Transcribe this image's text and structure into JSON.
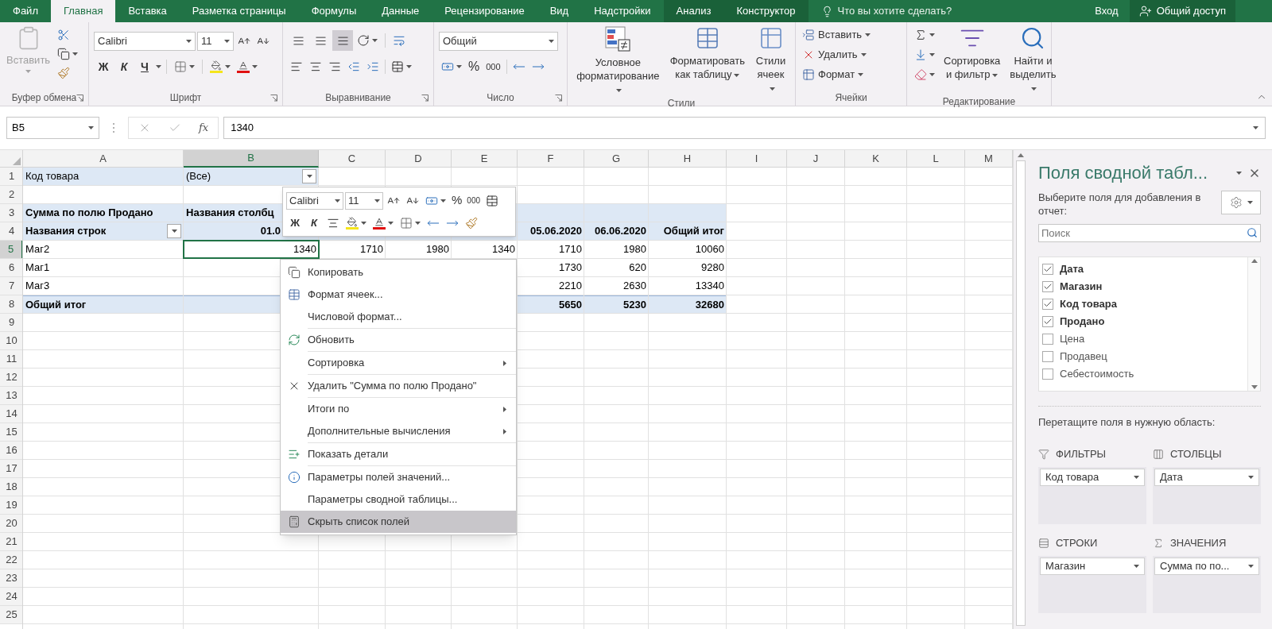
{
  "tabs": [
    {
      "label": "Файл",
      "selected": false,
      "contextual": false
    },
    {
      "label": "Главная",
      "selected": true,
      "contextual": false
    },
    {
      "label": "Вставка",
      "selected": false,
      "contextual": false
    },
    {
      "label": "Разметка страницы",
      "selected": false,
      "contextual": false
    },
    {
      "label": "Формулы",
      "selected": false,
      "contextual": false
    },
    {
      "label": "Данные",
      "selected": false,
      "contextual": false
    },
    {
      "label": "Рецензирование",
      "selected": false,
      "contextual": false
    },
    {
      "label": "Вид",
      "selected": false,
      "contextual": false
    },
    {
      "label": "Надстройки",
      "selected": false,
      "contextual": false
    },
    {
      "label": "Анализ",
      "selected": false,
      "contextual": true
    },
    {
      "label": "Конструктор",
      "selected": false,
      "contextual": true
    }
  ],
  "tell_me": {
    "placeholder": "Что вы хотите сделать?"
  },
  "account": {
    "sign_in": "Вход",
    "share": "Общий доступ"
  },
  "ribbon": {
    "clipboard": {
      "title": "Буфер обмена",
      "paste": {
        "label": "Вставить",
        "disabled": true
      }
    },
    "font": {
      "title": "Шрифт",
      "font": "Calibri",
      "size": "11",
      "bold": "Ж",
      "italic": "К",
      "underline": "Ч"
    },
    "alignment": {
      "title": "Выравнивание",
      "vertical": [
        {
          "selected": false
        },
        {
          "selected": false
        },
        {
          "selected": true
        }
      ]
    },
    "number": {
      "title": "Число",
      "format": "Общий",
      "percent": "%",
      "thousands": "000"
    },
    "styles": {
      "title": "Стили",
      "buttons": [
        {
          "kind": "conditional",
          "lines": [
            "Условное",
            "форматирование"
          ]
        },
        {
          "kind": "table",
          "lines": [
            "Форматировать",
            "как таблицу"
          ]
        },
        {
          "kind": "cell-styles",
          "lines": [
            "Стили",
            "ячеек"
          ]
        }
      ]
    },
    "cells": {
      "title": "Ячейки",
      "buttons": [
        {
          "kind": "insert",
          "label": "Вставить"
        },
        {
          "kind": "delete",
          "label": "Удалить"
        },
        {
          "kind": "format",
          "label": "Формат"
        }
      ]
    },
    "editing": {
      "title": "Редактирование",
      "buttons": [
        {
          "kind": "sort",
          "lines": [
            "Сортировка",
            "и фильтр"
          ]
        },
        {
          "kind": "find",
          "lines": [
            "Найти и",
            "выделить"
          ]
        }
      ]
    }
  },
  "formula_bar": {
    "name_box": "B5",
    "fx": "fx",
    "value": "1340"
  },
  "sheet": {
    "columns": [
      {
        "label": "A",
        "selected": false
      },
      {
        "label": "B",
        "selected": true
      },
      {
        "label": "C",
        "selected": false
      },
      {
        "label": "D",
        "selected": false
      },
      {
        "label": "E",
        "selected": false
      },
      {
        "label": "F",
        "selected": false
      },
      {
        "label": "G",
        "selected": false
      },
      {
        "label": "H",
        "selected": false
      },
      {
        "label": "I",
        "selected": false
      },
      {
        "label": "J",
        "selected": false
      },
      {
        "label": "K",
        "selected": false
      },
      {
        "label": "L",
        "selected": false
      },
      {
        "label": "M",
        "selected": false
      }
    ],
    "rows": [
      {
        "label": "1",
        "selected": false,
        "kind": "filter",
        "label_cells": [
          {
            "text": "Код товара",
            "kind": "text",
            "bold": false,
            "selected": false
          },
          {
            "text": "(Все)",
            "kind": "filter",
            "bold": false,
            "selected": false
          }
        ]
      },
      {
        "label": "2",
        "selected": false,
        "kind": "plain"
      },
      {
        "label": "3",
        "selected": false,
        "kind": "header",
        "label_cells": [
          {
            "text": "Сумма по полю Продано",
            "kind": "text",
            "bold": true,
            "selected": false
          },
          {
            "text": "Названия столбц",
            "kind": "text",
            "bold": true,
            "selected": false
          }
        ]
      },
      {
        "label": "4",
        "selected": false,
        "kind": "header",
        "label_cells": [
          {
            "text": "Названия строк",
            "kind": "filter",
            "bold": true,
            "selected": false
          },
          {
            "text": "01.0",
            "kind": "partial",
            "bold": true,
            "selected": false
          }
        ],
        "value_cells": [
          {
            "text": "05.06.2020",
            "bold": true,
            "selected": false
          },
          {
            "text": "06.06.2020",
            "bold": true,
            "selected": false
          },
          {
            "text": "Общий итог",
            "bold": true,
            "selected": false
          }
        ]
      },
      {
        "label": "5",
        "selected": true,
        "kind": "plain",
        "label_cells": [
          {
            "text": "Маг2",
            "kind": "text",
            "bold": false,
            "selected": false
          }
        ],
        "value_cells": [
          {
            "text": "1340",
            "bold": false,
            "selected": true
          },
          {
            "text": "1710",
            "bold": false,
            "selected": false
          },
          {
            "text": "1980",
            "bold": false,
            "selected": false
          },
          {
            "text": "1340",
            "bold": false,
            "selected": false
          },
          {
            "text": "1710",
            "bold": false,
            "selected": false
          },
          {
            "text": "1980",
            "bold": false,
            "selected": false
          },
          {
            "text": "10060",
            "bold": false,
            "selected": false
          }
        ]
      },
      {
        "label": "6",
        "selected": false,
        "kind": "plain",
        "label_cells": [
          {
            "text": "Маг1",
            "kind": "text",
            "bold": false,
            "selected": false
          }
        ],
        "value_cells": [
          {
            "text": "1730",
            "bold": false,
            "selected": false
          },
          {
            "text": "620",
            "bold": false,
            "selected": false
          },
          {
            "text": "9280",
            "bold": false,
            "selected": false
          }
        ]
      },
      {
        "label": "7",
        "selected": false,
        "kind": "plain",
        "label_cells": [
          {
            "text": "Маг3",
            "kind": "text",
            "bold": false,
            "selected": false
          }
        ],
        "value_cells": [
          {
            "text": "2210",
            "bold": false,
            "selected": false
          },
          {
            "text": "2630",
            "bold": false,
            "selected": false
          },
          {
            "text": "13340",
            "bold": false,
            "selected": false
          }
        ]
      },
      {
        "label": "8",
        "selected": false,
        "kind": "total",
        "label_cells": [
          {
            "text": "Общий итог",
            "kind": "text",
            "bold": true,
            "selected": false
          }
        ],
        "value_cells": [
          {
            "text": "5650",
            "bold": true,
            "selected": false
          },
          {
            "text": "5230",
            "bold": true,
            "selected": false
          },
          {
            "text": "32680",
            "bold": true,
            "selected": false
          }
        ]
      },
      {
        "label": "9",
        "selected": false,
        "kind": "plain"
      },
      {
        "label": "10",
        "selected": false,
        "kind": "plain"
      },
      {
        "label": "11",
        "selected": false,
        "kind": "plain"
      },
      {
        "label": "12",
        "selected": false,
        "kind": "plain"
      },
      {
        "label": "13",
        "selected": false,
        "kind": "plain"
      },
      {
        "label": "14",
        "selected": false,
        "kind": "plain"
      },
      {
        "label": "15",
        "selected": false,
        "kind": "plain"
      },
      {
        "label": "16",
        "selected": false,
        "kind": "plain"
      },
      {
        "label": "17",
        "selected": false,
        "kind": "plain"
      },
      {
        "label": "18",
        "selected": false,
        "kind": "plain"
      },
      {
        "label": "19",
        "selected": false,
        "kind": "plain"
      },
      {
        "label": "20",
        "selected": false,
        "kind": "plain"
      },
      {
        "label": "21",
        "selected": false,
        "kind": "plain"
      },
      {
        "label": "22",
        "selected": false,
        "kind": "plain"
      },
      {
        "label": "23",
        "selected": false,
        "kind": "plain"
      },
      {
        "label": "24",
        "selected": false,
        "kind": "plain"
      },
      {
        "label": "25",
        "selected": false,
        "kind": "plain"
      }
    ]
  },
  "mini_toolbar": {
    "font": "Calibri",
    "size": "11",
    "percent": "%",
    "thousands": "000",
    "bold": "Ж",
    "italic": "К"
  },
  "context_menu": {
    "groups": [
      [
        {
          "label": "Копировать",
          "kind": "copy",
          "submenu": false,
          "selected": false
        },
        {
          "label": "Формат ячеек...",
          "kind": "format-cells",
          "submenu": false,
          "selected": false
        },
        {
          "label": "Числовой формат...",
          "kind": "none",
          "submenu": false,
          "selected": false
        }
      ],
      [
        {
          "label": "Обновить",
          "kind": "refresh",
          "submenu": false,
          "selected": false
        }
      ],
      [
        {
          "label": "Сортировка",
          "kind": "none",
          "submenu": true,
          "selected": false
        }
      ],
      [
        {
          "label": "Удалить \"Сумма по полю Продано\"",
          "kind": "delete",
          "submenu": false,
          "selected": false
        }
      ],
      [
        {
          "label": "Итоги по",
          "kind": "none",
          "submenu": true,
          "selected": false
        },
        {
          "label": "Дополнительные вычисления",
          "kind": "none",
          "submenu": true,
          "selected": false
        }
      ],
      [
        {
          "label": "Показать детали",
          "kind": "show-details",
          "submenu": false,
          "selected": false
        }
      ],
      [
        {
          "label": "Параметры полей значений...",
          "kind": "field-settings",
          "submenu": false,
          "selected": false
        },
        {
          "label": "Параметры сводной таблицы...",
          "kind": "none",
          "submenu": false,
          "selected": false
        },
        {
          "label": "Скрыть список полей",
          "kind": "field-list",
          "submenu": false,
          "selected": true
        }
      ]
    ]
  },
  "pivot_panel": {
    "title": "Поля сводной табл...",
    "subtitle": "Выберите поля для добавления в отчет:",
    "search": {
      "placeholder": "Поиск"
    },
    "fields": [
      {
        "label": "Дата",
        "checked": true
      },
      {
        "label": "Магазин",
        "checked": true
      },
      {
        "label": "Код товара",
        "checked": true
      },
      {
        "label": "Продано",
        "checked": true
      },
      {
        "label": "Цена",
        "checked": false
      },
      {
        "label": "Продавец",
        "checked": false
      },
      {
        "label": "Себестоимость",
        "checked": false
      }
    ],
    "drag_hint": "Перетащите поля в нужную область:",
    "areas": [
      {
        "kind": "filters",
        "title": "ФИЛЬТРЫ",
        "items": [
          "Код товара"
        ]
      },
      {
        "kind": "columns",
        "title": "СТОЛБЦЫ",
        "items": [
          "Дата"
        ]
      },
      {
        "kind": "rows",
        "title": "СТРОКИ",
        "items": [
          "Магазин"
        ]
      },
      {
        "kind": "values",
        "title": "ЗНАЧЕНИЯ",
        "items": [
          "Сумма по по..."
        ]
      }
    ]
  }
}
